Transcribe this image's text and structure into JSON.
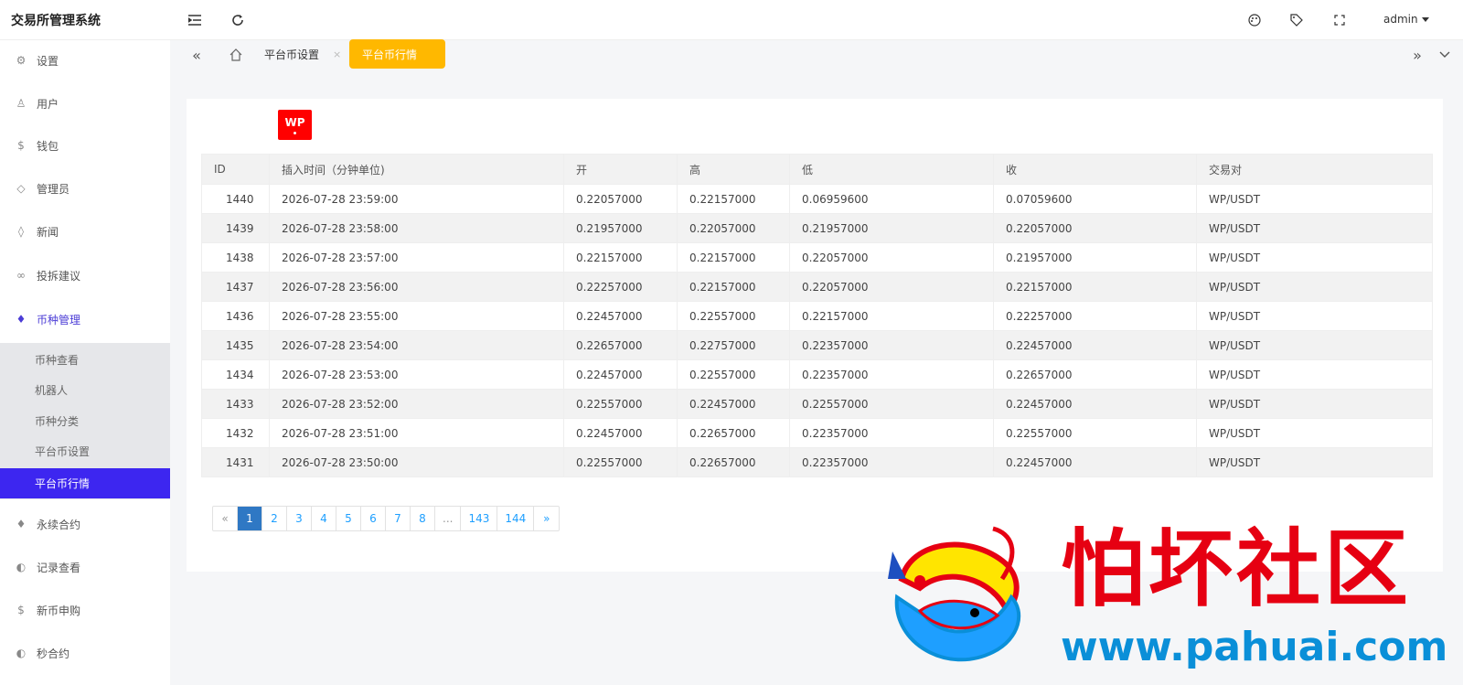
{
  "header": {
    "brand": "交易所管理系统",
    "user": "admin",
    "icons": [
      "menu-fold-icon",
      "refresh-icon",
      "theme-icon",
      "tag-icon",
      "fullscreen-icon"
    ]
  },
  "sidebar": {
    "items": [
      {
        "label": "设置",
        "icon": "gear-icon"
      },
      {
        "label": "用户",
        "icon": "user-icon"
      },
      {
        "label": "钱包",
        "icon": "coin-icon"
      },
      {
        "label": "管理员",
        "icon": "shield-icon"
      },
      {
        "label": "新闻",
        "icon": "tag-icon"
      },
      {
        "label": "投拆建议",
        "icon": "link-icon"
      },
      {
        "label": "币种管理",
        "icon": "diamond-icon"
      }
    ],
    "submenu": [
      {
        "label": "币种查看"
      },
      {
        "label": "机器人"
      },
      {
        "label": "币种分类"
      },
      {
        "label": "平台币设置"
      },
      {
        "label": "平台币行情"
      }
    ],
    "items_after": [
      {
        "label": "永续合约",
        "icon": "diamond-icon"
      },
      {
        "label": "记录查看",
        "icon": "history-icon"
      },
      {
        "label": "新币申购",
        "icon": "coin-icon"
      },
      {
        "label": "秒合约",
        "icon": "history-icon"
      }
    ]
  },
  "tabs": {
    "items": [
      {
        "label": "平台币设置"
      },
      {
        "label": "平台币行情"
      }
    ],
    "close_glyph": "×"
  },
  "coin": {
    "symbol": "WP",
    "color": "#ff0000"
  },
  "table": {
    "headers": [
      "ID",
      "插入时间（分钟单位)",
      "开",
      "高",
      "低",
      "收",
      "交易对"
    ],
    "rows": [
      [
        "1440",
        "2026-07-28 23:59:00",
        "0.22057000",
        "0.22157000",
        "0.06959600",
        "0.07059600",
        "WP/USDT"
      ],
      [
        "1439",
        "2026-07-28 23:58:00",
        "0.21957000",
        "0.22057000",
        "0.21957000",
        "0.22057000",
        "WP/USDT"
      ],
      [
        "1438",
        "2026-07-28 23:57:00",
        "0.22157000",
        "0.22157000",
        "0.22057000",
        "0.21957000",
        "WP/USDT"
      ],
      [
        "1437",
        "2026-07-28 23:56:00",
        "0.22257000",
        "0.22157000",
        "0.22057000",
        "0.22157000",
        "WP/USDT"
      ],
      [
        "1436",
        "2026-07-28 23:55:00",
        "0.22457000",
        "0.22557000",
        "0.22157000",
        "0.22257000",
        "WP/USDT"
      ],
      [
        "1435",
        "2026-07-28 23:54:00",
        "0.22657000",
        "0.22757000",
        "0.22357000",
        "0.22457000",
        "WP/USDT"
      ],
      [
        "1434",
        "2026-07-28 23:53:00",
        "0.22457000",
        "0.22557000",
        "0.22357000",
        "0.22657000",
        "WP/USDT"
      ],
      [
        "1433",
        "2026-07-28 23:52:00",
        "0.22557000",
        "0.22457000",
        "0.22557000",
        "0.22457000",
        "WP/USDT"
      ],
      [
        "1432",
        "2026-07-28 23:51:00",
        "0.22457000",
        "0.22657000",
        "0.22357000",
        "0.22557000",
        "WP/USDT"
      ],
      [
        "1431",
        "2026-07-28 23:50:00",
        "0.22557000",
        "0.22657000",
        "0.22357000",
        "0.22457000",
        "WP/USDT"
      ]
    ]
  },
  "pagination": {
    "pages": [
      "«",
      "1",
      "2",
      "3",
      "4",
      "5",
      "6",
      "7",
      "8",
      "...",
      "143",
      "144",
      "»"
    ],
    "current": "1"
  },
  "watermark": {
    "title": "怕坏社区",
    "url": "www.pahuai.com",
    "title_color": "#e60012",
    "url_color": "#0a8fd8"
  },
  "colors": {
    "accent": "#3d26f0",
    "tab_active": "#ffb800",
    "page_current": "#2f78c4"
  }
}
